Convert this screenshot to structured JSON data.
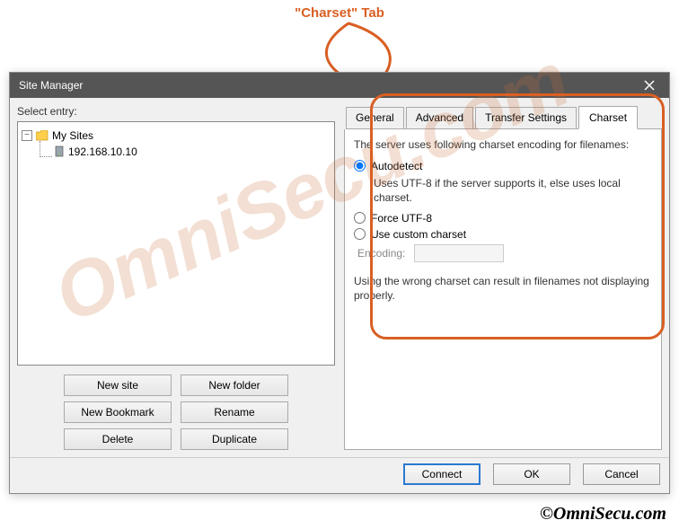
{
  "annotation": {
    "label": "\"Charset\" Tab"
  },
  "dialog": {
    "title": "Site Manager",
    "select_entry_label": "Select entry:"
  },
  "tree": {
    "root_label": "My Sites",
    "child1_label": "192.168.10.10"
  },
  "left_buttons": {
    "new_site": "New site",
    "new_folder": "New folder",
    "new_bookmark": "New Bookmark",
    "rename": "Rename",
    "delete": "Delete",
    "duplicate": "Duplicate"
  },
  "tabs": {
    "general": "General",
    "advanced": "Advanced",
    "transfer": "Transfer Settings",
    "charset": "Charset"
  },
  "charset_panel": {
    "intro": "The server uses following charset encoding for filenames:",
    "autodetect": "Autodetect",
    "autodetect_desc": "Uses UTF-8 if the server supports it, else uses local charset.",
    "force_utf8": "Force UTF-8",
    "use_custom": "Use custom charset",
    "encoding_label": "Encoding:",
    "encoding_value": "",
    "warning": "Using the wrong charset can result in filenames not displaying properly."
  },
  "bottom": {
    "connect": "Connect",
    "ok": "OK",
    "cancel": "Cancel"
  },
  "watermark": "OmniSecu.com",
  "copyright": "©OmniSecu.com"
}
